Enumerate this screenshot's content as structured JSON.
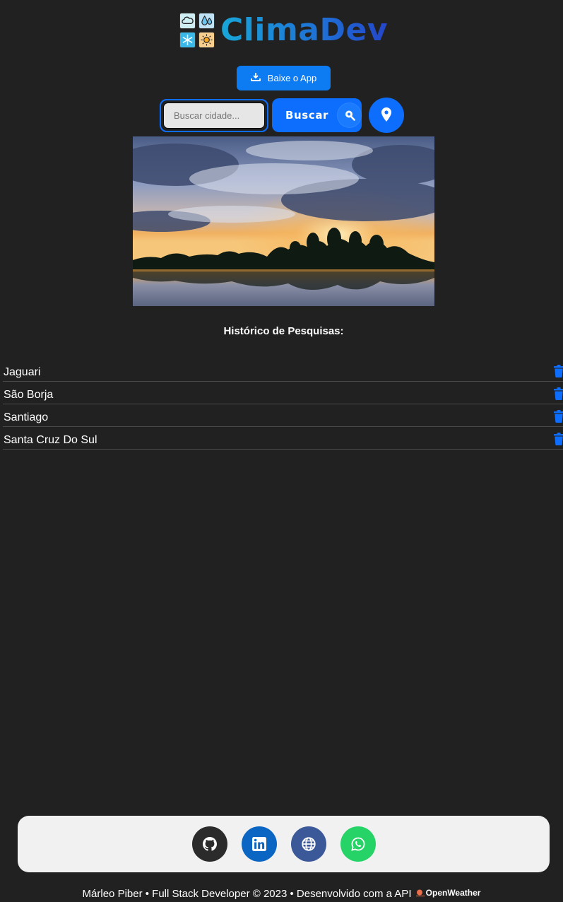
{
  "brand": {
    "name": "ClimaDev"
  },
  "app_button": {
    "label": "Baixe o App",
    "icon": "download-icon"
  },
  "search": {
    "placeholder": "Buscar cidade...",
    "value": "",
    "button_label": "Buscar",
    "button_icon": "search-icon",
    "location_icon": "map-pin-icon"
  },
  "history": {
    "title": "Histórico de Pesquisas:",
    "items": [
      {
        "city": "Jaguari"
      },
      {
        "city": "São Borja"
      },
      {
        "city": "Santiago"
      },
      {
        "city": "Santa Cruz Do Sul"
      }
    ],
    "delete_icon": "trash-icon"
  },
  "socials": [
    {
      "name": "github",
      "icon": "github-icon",
      "color": "#2b2b2b"
    },
    {
      "name": "linkedin",
      "icon": "linkedin-icon",
      "color": "#0a66c2"
    },
    {
      "name": "website",
      "icon": "globe-icon",
      "color": "#3b5998"
    },
    {
      "name": "whatsapp",
      "icon": "whatsapp-icon",
      "color": "#25d366"
    }
  ],
  "footer": {
    "credits": "Márleo Piber • Full Stack Developer © 2023 • Desenvolvido com a API",
    "api_name": "OpenWeather"
  },
  "colors": {
    "background": "#212121",
    "accent": "#0d6efd",
    "social_bar": "#f1f1f1"
  }
}
